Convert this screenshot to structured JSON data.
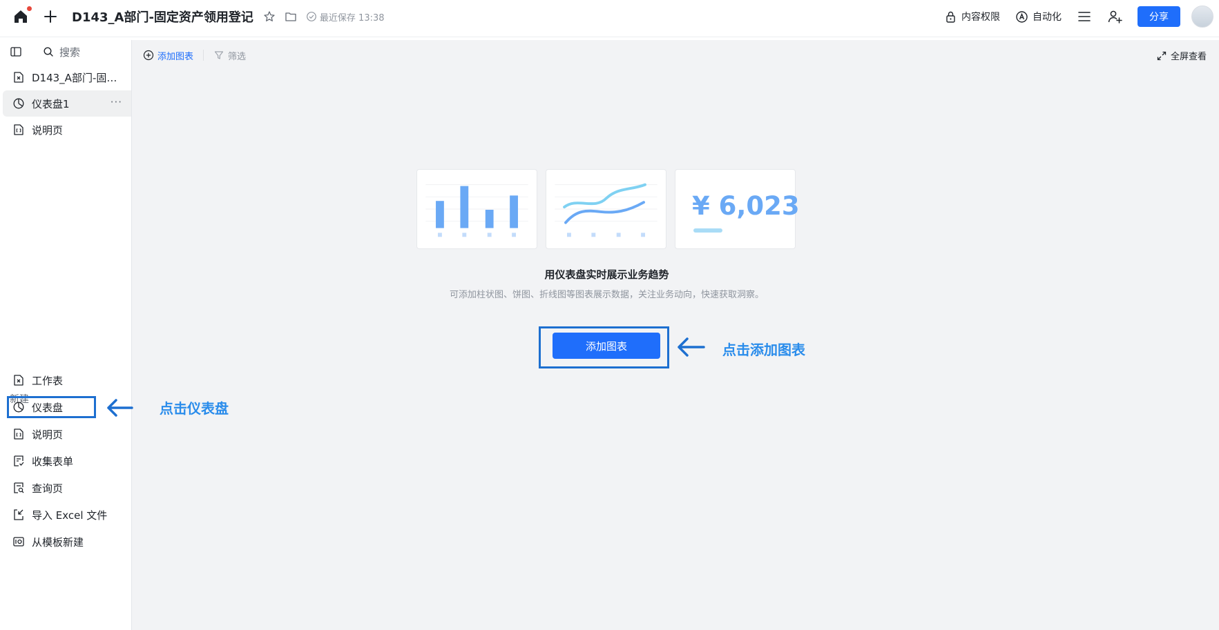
{
  "app": {
    "title": "D143_A部门-固定资产领用登记",
    "saved_text": "最近保存 13:38"
  },
  "topbar": {
    "permission_label": "内容权限",
    "automation_label": "自动化",
    "share_label": "分享"
  },
  "sidebar": {
    "search_placeholder": "搜索",
    "items": [
      {
        "label": "D143_A部门-固…",
        "icon": "sheet-icon"
      },
      {
        "label": "仪表盘1",
        "icon": "dashboard-icon",
        "active": true,
        "more": "···"
      },
      {
        "label": "说明页",
        "icon": "doc-page-icon"
      }
    ],
    "new_section_label": "新建",
    "new_items": [
      {
        "label": "工作表",
        "icon": "sheet-icon"
      },
      {
        "label": "仪表盘",
        "icon": "dashboard-icon"
      },
      {
        "label": "说明页",
        "icon": "doc-page-icon"
      },
      {
        "label": "收集表单",
        "icon": "form-icon"
      },
      {
        "label": "查询页",
        "icon": "query-icon"
      },
      {
        "label": "导入 Excel 文件",
        "icon": "import-icon"
      },
      {
        "label": "从模板新建",
        "icon": "template-icon"
      }
    ]
  },
  "main": {
    "add_chart_label": "添加图表",
    "filter_label": "筛选",
    "fullscreen_label": "全屏查看",
    "kpi_value": "¥ 6,023",
    "empty_title": "用仪表盘实时展示业务趋势",
    "empty_subtitle": "可添加柱状图、饼图、折线图等图表展示数据，关注业务动向，快速获取洞察。",
    "add_chart_button": "添加图表"
  },
  "annotations": {
    "click_dashboard": "点击仪表盘",
    "click_add_chart": "点击添加图表",
    "color": "#1d6fd0"
  },
  "colors": {
    "accent": "#1f6efb",
    "main_bg": "#f2f3f5"
  }
}
